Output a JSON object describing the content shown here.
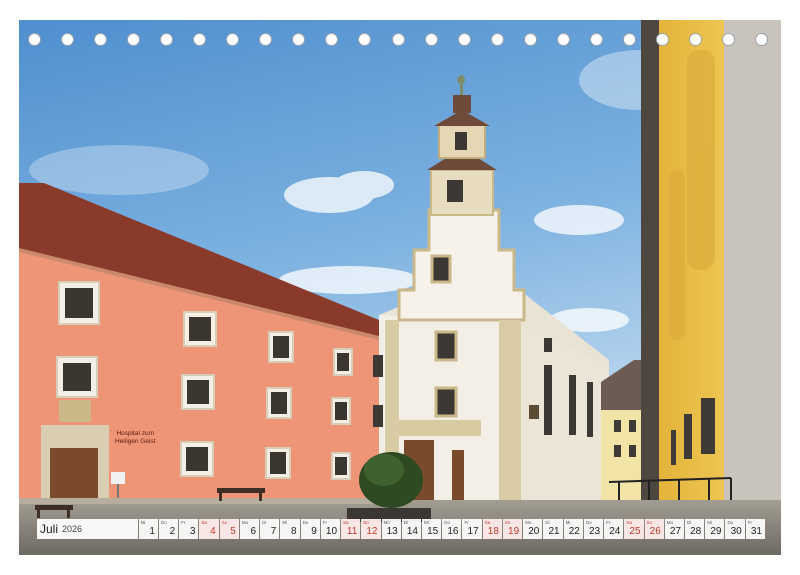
{
  "photo": {
    "description_sign_line1": "Hospital zum",
    "description_sign_line2": "Heiligen Geist",
    "colors": {
      "sky": "#5f9fd6",
      "sky_light": "#cfe2f3",
      "pink_facade": "#ef9577",
      "roof": "#8a3a2a",
      "white_church": "#f3efe6",
      "stone": "#d2c08c",
      "yellow_facade": "#f0c84e",
      "ground": "#8b8780"
    }
  },
  "calendar": {
    "month": "Juli",
    "year": "2026",
    "days": [
      {
        "wd": "Mi",
        "n": "1",
        "we": false
      },
      {
        "wd": "Do",
        "n": "2",
        "we": false
      },
      {
        "wd": "Fr",
        "n": "3",
        "we": false
      },
      {
        "wd": "Sa",
        "n": "4",
        "we": true
      },
      {
        "wd": "So",
        "n": "5",
        "we": true
      },
      {
        "wd": "Mo",
        "n": "6",
        "we": false
      },
      {
        "wd": "Di",
        "n": "7",
        "we": false
      },
      {
        "wd": "Mi",
        "n": "8",
        "we": false
      },
      {
        "wd": "Do",
        "n": "9",
        "we": false
      },
      {
        "wd": "Fr",
        "n": "10",
        "we": false
      },
      {
        "wd": "Sa",
        "n": "11",
        "we": true
      },
      {
        "wd": "So",
        "n": "12",
        "we": true
      },
      {
        "wd": "Mo",
        "n": "13",
        "we": false
      },
      {
        "wd": "Di",
        "n": "14",
        "we": false
      },
      {
        "wd": "Mi",
        "n": "15",
        "we": false
      },
      {
        "wd": "Do",
        "n": "16",
        "we": false
      },
      {
        "wd": "Fr",
        "n": "17",
        "we": false
      },
      {
        "wd": "Sa",
        "n": "18",
        "we": true
      },
      {
        "wd": "So",
        "n": "19",
        "we": true
      },
      {
        "wd": "Mo",
        "n": "20",
        "we": false
      },
      {
        "wd": "Di",
        "n": "21",
        "we": false
      },
      {
        "wd": "Mi",
        "n": "22",
        "we": false
      },
      {
        "wd": "Do",
        "n": "23",
        "we": false
      },
      {
        "wd": "Fr",
        "n": "24",
        "we": false
      },
      {
        "wd": "Sa",
        "n": "25",
        "we": true
      },
      {
        "wd": "So",
        "n": "26",
        "we": true
      },
      {
        "wd": "Mo",
        "n": "27",
        "we": false
      },
      {
        "wd": "Di",
        "n": "28",
        "we": false
      },
      {
        "wd": "Mi",
        "n": "29",
        "we": false
      },
      {
        "wd": "Do",
        "n": "30",
        "we": false
      },
      {
        "wd": "Fr",
        "n": "31",
        "we": false
      }
    ]
  },
  "binding_holes": {
    "count": 23
  }
}
